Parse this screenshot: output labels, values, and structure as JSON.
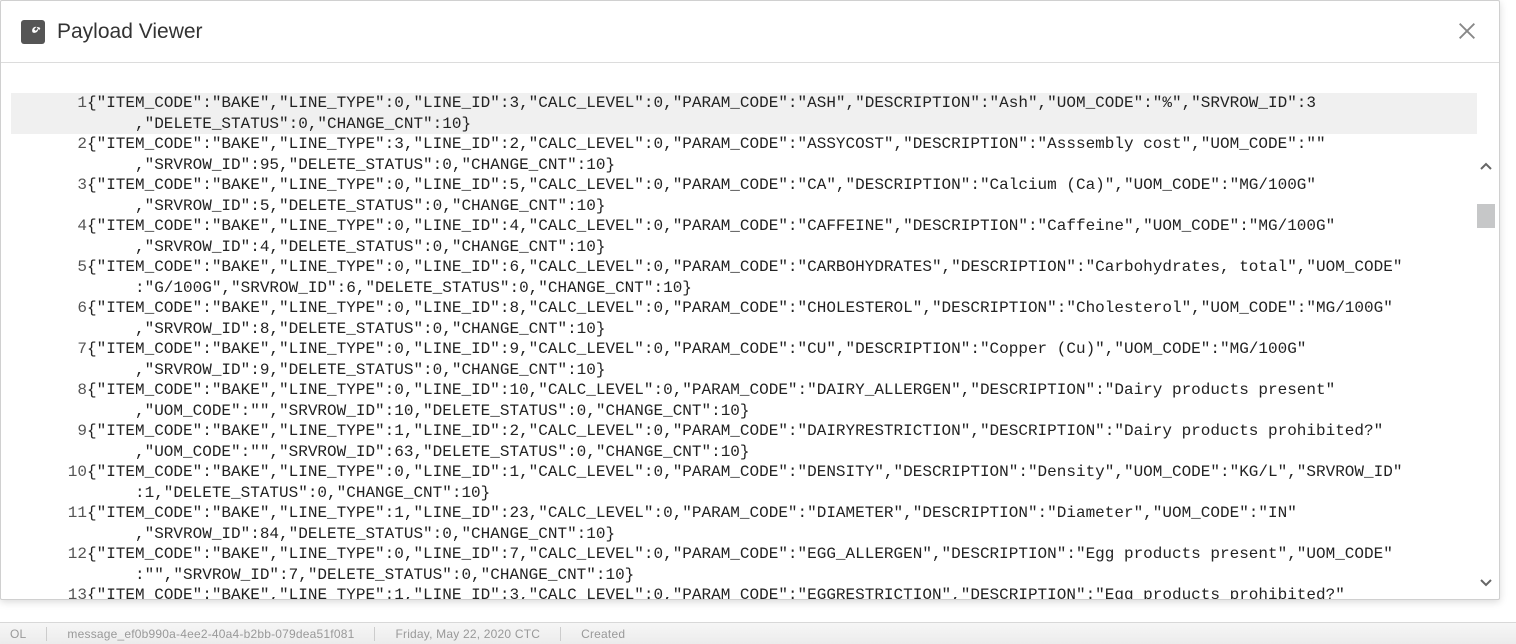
{
  "dialog": {
    "title": "Payload Viewer"
  },
  "icons": {
    "title": "wrench-icon",
    "close": "close-icon",
    "scroll_up": "chevron-up-icon",
    "scroll_down": "chevron-down-icon"
  },
  "footer": {
    "segment1": "OL",
    "segment2": "message_ef0b990a-4ee2-40a4-b2bb-079dea51f081",
    "segment3": "Friday, May 22, 2020 CTC",
    "segment4": "Created"
  },
  "payload_rows": [
    {
      "n": 1,
      "text": "{\"ITEM_CODE\":\"BAKE\",\"LINE_TYPE\":0,\"LINE_ID\":3,\"CALC_LEVEL\":0,\"PARAM_CODE\":\"ASH\",\"DESCRIPTION\":\"Ash\",\"UOM_CODE\":\"%\",\"SRVROW_ID\":3",
      "wrap": ",\"DELETE_STATUS\":0,\"CHANGE_CNT\":10}",
      "hl": true
    },
    {
      "n": 2,
      "text": "{\"ITEM_CODE\":\"BAKE\",\"LINE_TYPE\":3,\"LINE_ID\":2,\"CALC_LEVEL\":0,\"PARAM_CODE\":\"ASSYCOST\",\"DESCRIPTION\":\"Asssembly cost\",\"UOM_CODE\":\"\"",
      "wrap": ",\"SRVROW_ID\":95,\"DELETE_STATUS\":0,\"CHANGE_CNT\":10}"
    },
    {
      "n": 3,
      "text": "{\"ITEM_CODE\":\"BAKE\",\"LINE_TYPE\":0,\"LINE_ID\":5,\"CALC_LEVEL\":0,\"PARAM_CODE\":\"CA\",\"DESCRIPTION\":\"Calcium (Ca)\",\"UOM_CODE\":\"MG/100G\"",
      "wrap": ",\"SRVROW_ID\":5,\"DELETE_STATUS\":0,\"CHANGE_CNT\":10}"
    },
    {
      "n": 4,
      "text": "{\"ITEM_CODE\":\"BAKE\",\"LINE_TYPE\":0,\"LINE_ID\":4,\"CALC_LEVEL\":0,\"PARAM_CODE\":\"CAFFEINE\",\"DESCRIPTION\":\"Caffeine\",\"UOM_CODE\":\"MG/100G\"",
      "wrap": ",\"SRVROW_ID\":4,\"DELETE_STATUS\":0,\"CHANGE_CNT\":10}"
    },
    {
      "n": 5,
      "text": "{\"ITEM_CODE\":\"BAKE\",\"LINE_TYPE\":0,\"LINE_ID\":6,\"CALC_LEVEL\":0,\"PARAM_CODE\":\"CARBOHYDRATES\",\"DESCRIPTION\":\"Carbohydrates, total\",\"UOM_CODE\"",
      "wrap": ":\"G/100G\",\"SRVROW_ID\":6,\"DELETE_STATUS\":0,\"CHANGE_CNT\":10}"
    },
    {
      "n": 6,
      "text": "{\"ITEM_CODE\":\"BAKE\",\"LINE_TYPE\":0,\"LINE_ID\":8,\"CALC_LEVEL\":0,\"PARAM_CODE\":\"CHOLESTEROL\",\"DESCRIPTION\":\"Cholesterol\",\"UOM_CODE\":\"MG/100G\"",
      "wrap": ",\"SRVROW_ID\":8,\"DELETE_STATUS\":0,\"CHANGE_CNT\":10}"
    },
    {
      "n": 7,
      "text": "{\"ITEM_CODE\":\"BAKE\",\"LINE_TYPE\":0,\"LINE_ID\":9,\"CALC_LEVEL\":0,\"PARAM_CODE\":\"CU\",\"DESCRIPTION\":\"Copper (Cu)\",\"UOM_CODE\":\"MG/100G\"",
      "wrap": ",\"SRVROW_ID\":9,\"DELETE_STATUS\":0,\"CHANGE_CNT\":10}"
    },
    {
      "n": 8,
      "text": "{\"ITEM_CODE\":\"BAKE\",\"LINE_TYPE\":0,\"LINE_ID\":10,\"CALC_LEVEL\":0,\"PARAM_CODE\":\"DAIRY_ALLERGEN\",\"DESCRIPTION\":\"Dairy products present\"",
      "wrap": ",\"UOM_CODE\":\"\",\"SRVROW_ID\":10,\"DELETE_STATUS\":0,\"CHANGE_CNT\":10}"
    },
    {
      "n": 9,
      "text": "{\"ITEM_CODE\":\"BAKE\",\"LINE_TYPE\":1,\"LINE_ID\":2,\"CALC_LEVEL\":0,\"PARAM_CODE\":\"DAIRYRESTRICTION\",\"DESCRIPTION\":\"Dairy products prohibited?\"",
      "wrap": ",\"UOM_CODE\":\"\",\"SRVROW_ID\":63,\"DELETE_STATUS\":0,\"CHANGE_CNT\":10}"
    },
    {
      "n": 10,
      "text": "{\"ITEM_CODE\":\"BAKE\",\"LINE_TYPE\":0,\"LINE_ID\":1,\"CALC_LEVEL\":0,\"PARAM_CODE\":\"DENSITY\",\"DESCRIPTION\":\"Density\",\"UOM_CODE\":\"KG/L\",\"SRVROW_ID\"",
      "wrap": ":1,\"DELETE_STATUS\":0,\"CHANGE_CNT\":10}"
    },
    {
      "n": 11,
      "text": "{\"ITEM_CODE\":\"BAKE\",\"LINE_TYPE\":1,\"LINE_ID\":23,\"CALC_LEVEL\":0,\"PARAM_CODE\":\"DIAMETER\",\"DESCRIPTION\":\"Diameter\",\"UOM_CODE\":\"IN\"",
      "wrap": ",\"SRVROW_ID\":84,\"DELETE_STATUS\":0,\"CHANGE_CNT\":10}"
    },
    {
      "n": 12,
      "text": "{\"ITEM_CODE\":\"BAKE\",\"LINE_TYPE\":0,\"LINE_ID\":7,\"CALC_LEVEL\":0,\"PARAM_CODE\":\"EGG_ALLERGEN\",\"DESCRIPTION\":\"Egg products present\",\"UOM_CODE\"",
      "wrap": ":\"\",\"SRVROW_ID\":7,\"DELETE_STATUS\":0,\"CHANGE_CNT\":10}"
    },
    {
      "n": 13,
      "text": "{\"ITEM_CODE\":\"BAKE\",\"LINE_TYPE\":1,\"LINE_ID\":3,\"CALC_LEVEL\":0,\"PARAM_CODE\":\"EGGRESTRICTION\",\"DESCRIPTION\":\"Egg products prohibited?\"",
      "wrap": ""
    }
  ]
}
